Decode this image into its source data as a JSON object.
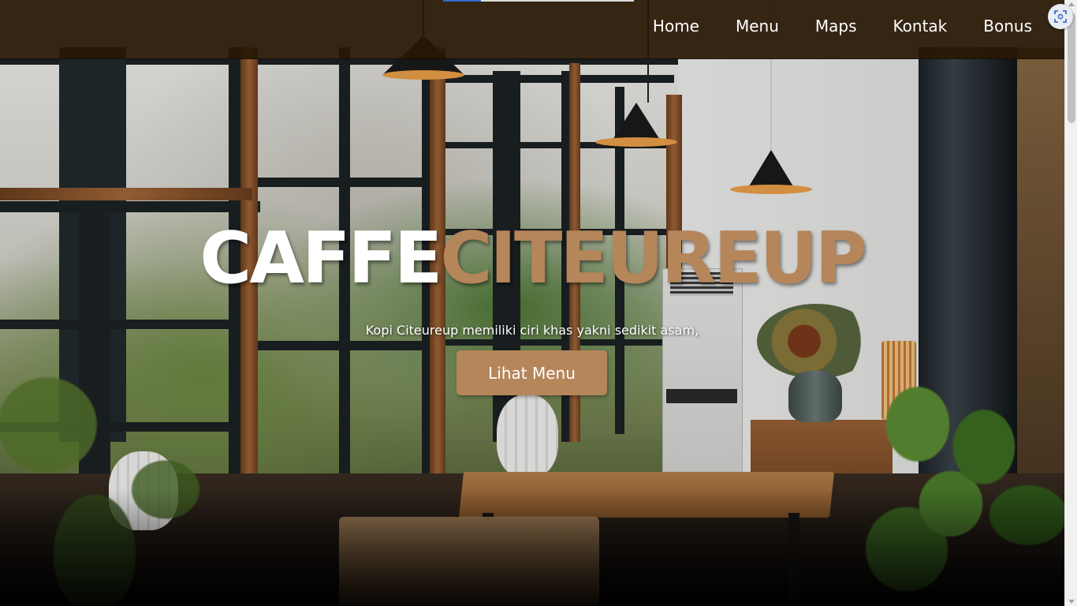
{
  "navbar": {
    "links": [
      "Home",
      "Menu",
      "Maps",
      "Kontak",
      "Bonus"
    ]
  },
  "hero": {
    "title_part1": "CAFFE",
    "title_part2": "CITEUREUP",
    "subtitle": "Kopi Citeureup memiliki ciri khas yakni sedikit asam,",
    "cta_label": "Lihat Menu"
  },
  "colors": {
    "accent": "#b5865a",
    "navbar_bg": "#281804",
    "text_light": "#ffffff",
    "progress_fill": "#2f6fd0"
  },
  "page_progress": 0.2,
  "icons": {
    "extension": "screenshot-capture-icon"
  }
}
